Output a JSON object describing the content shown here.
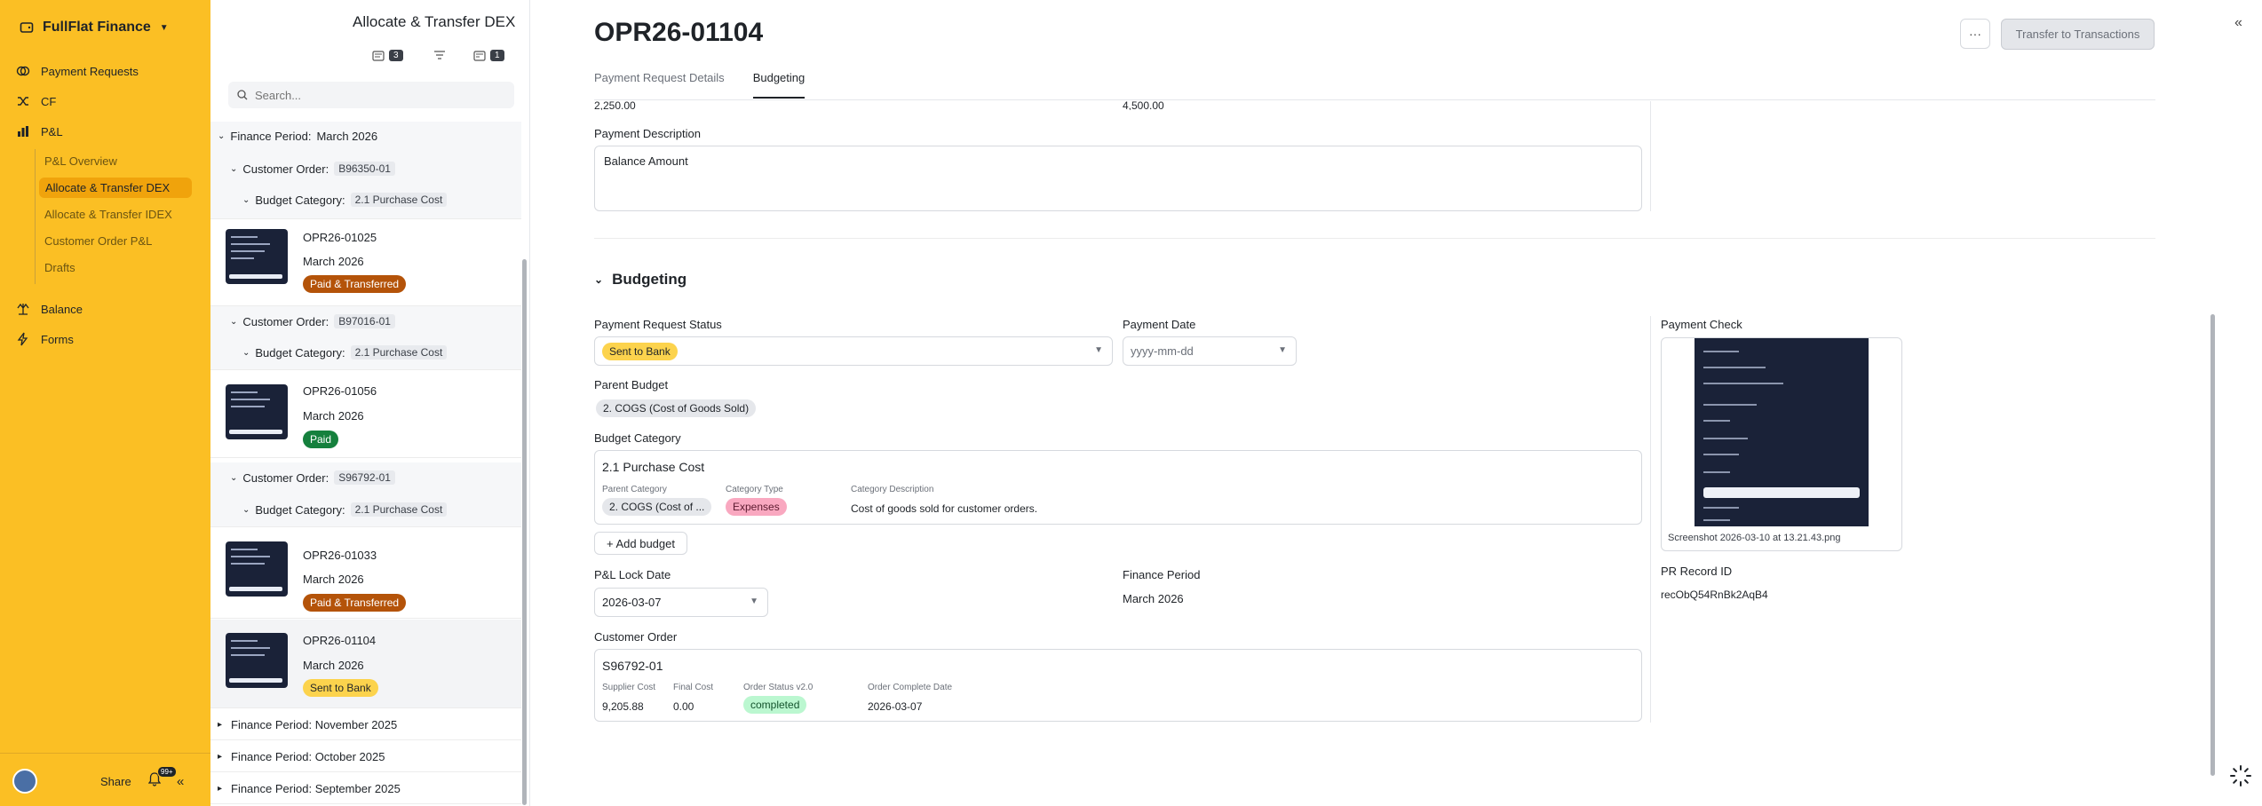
{
  "app": {
    "name": "FullFlat Finance",
    "nav": {
      "payment_requests": "Payment Requests",
      "cf": "CF",
      "pl": "P&L",
      "pl_sub": [
        "P&L Overview",
        "Allocate & Transfer DEX",
        "Allocate & Transfer IDEX",
        "Customer Order P&L",
        "Drafts"
      ],
      "balance": "Balance",
      "forms": "Forms"
    },
    "footer": {
      "share": "Share",
      "notif_count": "99+"
    }
  },
  "list": {
    "title": "Allocate & Transfer DEX",
    "count_left": "3",
    "count_right": "1",
    "search_placeholder": "Search...",
    "group_finance_label": "Finance Period:",
    "group_finance_value": "March 2026",
    "customer_order_label": "Customer Order:",
    "budget_category_label": "Budget Category:",
    "orders": [
      "B96350-01",
      "B97016-01",
      "S96792-01"
    ],
    "budget_category_value": "2.1 Purchase Cost",
    "cards": [
      {
        "id": "OPR26-01025",
        "date": "March 2026",
        "status": "Paid & Transferred"
      },
      {
        "id": "OPR26-01056",
        "date": "March 2026",
        "status": "Paid"
      },
      {
        "id": "OPR26-01033",
        "date": "March 2026",
        "status": "Paid & Transferred"
      },
      {
        "id": "OPR26-01104",
        "date": "March 2026",
        "status": "Sent to Bank"
      }
    ],
    "other_periods": [
      "November 2025",
      "October 2025",
      "September 2025"
    ]
  },
  "detail": {
    "title": "OPR26-01104",
    "more_label": "···",
    "transfer_label": "Transfer to Transactions",
    "tabs": [
      "Payment Request Details",
      "Budgeting"
    ],
    "partial_amount_left": "2,250.00",
    "partial_amount_right": "4,500.00",
    "payment_description_label": "Payment Description",
    "payment_description": "Balance Amount",
    "section_title": "Budgeting",
    "payment_request_status_label": "Payment Request Status",
    "payment_request_status": "Sent to Bank",
    "payment_date_label": "Payment Date",
    "payment_date_placeholder": "yyyy-mm-dd",
    "parent_budget_label": "Parent Budget",
    "parent_budget": "2. COGS (Cost of Goods Sold)",
    "budget_category_label": "Budget Category",
    "budget_category": {
      "title": "2.1 Purchase Cost",
      "parent_category_label": "Parent Category",
      "parent_category": "2. COGS (Cost of ...",
      "category_type_label": "Category Type",
      "category_type": "Expenses",
      "category_description_label": "Category Description",
      "category_description": "Cost of goods sold for customer orders."
    },
    "add_budget_label": "Add budget",
    "pl_lock_date_label": "P&L Lock Date",
    "pl_lock_date": "2026-03-07",
    "finance_period_label": "Finance Period",
    "finance_period": "March 2026",
    "customer_order_label": "Customer Order",
    "customer_order": {
      "title": "S96792-01",
      "supplier_cost_label": "Supplier Cost",
      "supplier_cost": "9,205.88",
      "final_cost_label": "Final Cost",
      "final_cost": "0.00",
      "order_status_label": "Order Status v2.0",
      "order_status": "completed",
      "order_complete_date_label": "Order Complete Date",
      "order_complete_date": "2026-03-07"
    },
    "payment_check_label": "Payment Check",
    "payment_check_caption": "Screenshot 2026-03-10 at 13.21.43.png",
    "pr_record_id_label": "PR Record ID",
    "pr_record_id": "recObQ54RnBk2AqB4"
  }
}
